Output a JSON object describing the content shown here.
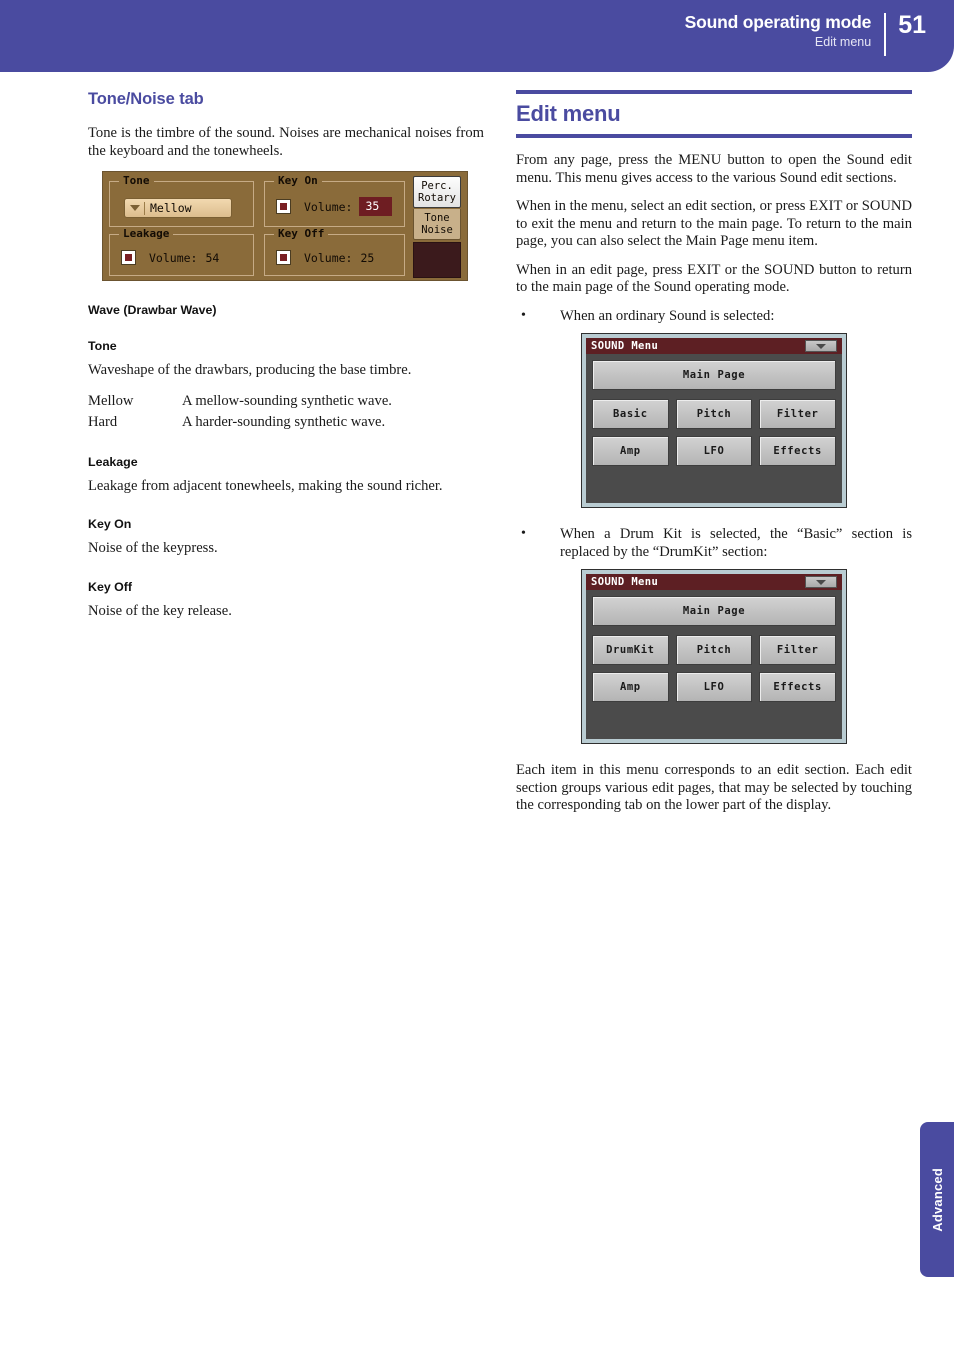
{
  "header": {
    "title": "Sound operating mode",
    "subtitle": "Edit menu",
    "page_number": "51",
    "accent_color": "#4a4ba0"
  },
  "left_column": {
    "section_heading": "Tone/Noise tab",
    "intro": "Tone is the timbre of the sound. Noises are mechanical noises from the keyboard and the tonewheels.",
    "device_panel": {
      "groups": {
        "tone": {
          "label": "Tone",
          "dropdown_value": "Mellow"
        },
        "key_on": {
          "label": "Key On",
          "volume_label": "Volume:",
          "volume_value": "35"
        },
        "leakage": {
          "label": "Leakage",
          "volume_label": "Volume:",
          "volume_value": "54"
        },
        "key_off": {
          "label": "Key Off",
          "volume_label": "Volume:",
          "volume_value": "25"
        }
      },
      "tabs": {
        "perc_rotary_line1": "Perc.",
        "perc_rotary_line2": "Rotary",
        "tone_noise_line1": "Tone",
        "tone_noise_line2": "Noise"
      }
    },
    "wave_heading": "Wave (Drawbar Wave)",
    "tone_heading": "Tone",
    "tone_desc": "Waveshape of the drawbars, producing the base timbre.",
    "tone_options": [
      {
        "term": "Mellow",
        "desc": "A mellow-sounding synthetic wave."
      },
      {
        "term": "Hard",
        "desc": "A harder-sounding synthetic wave."
      }
    ],
    "leakage_heading": "Leakage",
    "leakage_desc": "Leakage from adjacent tonewheels, making the sound richer.",
    "key_on_heading": "Key On",
    "key_on_desc": "Noise of the keypress.",
    "key_off_heading": "Key Off",
    "key_off_desc": "Noise of the key release."
  },
  "right_column": {
    "heading": "Edit menu",
    "paragraph_1": "From any page, press the MENU button to open the Sound edit menu. This menu gives access to the various Sound edit sections.",
    "paragraph_2": "When in the menu, select an edit section, or press EXIT or SOUND to exit the menu and return to the main page. To return to the main page, you can also select the Main Page menu item.",
    "paragraph_3": "When in an edit page, press EXIT or the SOUND button to return to the main page of the Sound operating mode.",
    "bullet_1": "When an ordinary Sound is selected:",
    "bullet_2": "When a Drum Kit is selected, the “Basic” section is replaced by the “DrumKit” section:",
    "paragraph_4": "Each item in this menu corresponds to an edit section. Each edit section groups various edit pages, that may be selected by touching the corresponding tab on the lower part of the display.",
    "sound_menu_ordinary": {
      "title": "SOUND Menu",
      "main_page_button": "Main Page",
      "buttons": [
        "Basic",
        "Pitch",
        "Filter",
        "Amp",
        "LFO",
        "Effects"
      ]
    },
    "sound_menu_drumkit": {
      "title": "SOUND Menu",
      "main_page_button": "Main Page",
      "buttons": [
        "DrumKit",
        "Pitch",
        "Filter",
        "Amp",
        "LFO",
        "Effects"
      ]
    }
  },
  "side_tab": {
    "label": "Advanced"
  }
}
